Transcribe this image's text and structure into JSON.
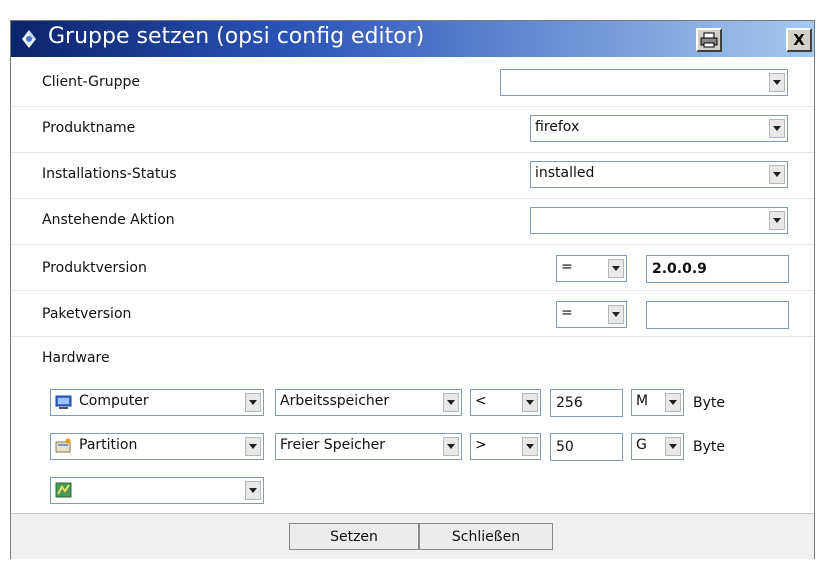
{
  "window": {
    "title": "Gruppe setzen (opsi config editor)",
    "print_icon": "printer-icon",
    "close_label": "X"
  },
  "form": {
    "client_group": {
      "label": "Client-Gruppe",
      "value": ""
    },
    "product_name": {
      "label": "Produktname",
      "value": "firefox"
    },
    "install_status": {
      "label": "Installations-Status",
      "value": "installed"
    },
    "pending_action": {
      "label": "Anstehende Aktion",
      "value": ""
    },
    "product_version": {
      "label": "Produktversion",
      "operator": "=",
      "value": "2.0.0.9"
    },
    "package_version": {
      "label": "Paketversion",
      "operator": "=",
      "value": ""
    }
  },
  "hardware": {
    "label": "Hardware",
    "rows": [
      {
        "device": "Computer",
        "device_icon": "computer-icon",
        "property": "Arbeitsspeicher",
        "operator": "<",
        "value": "256",
        "unit": "M",
        "suffix": "Byte"
      },
      {
        "device": "Partition",
        "device_icon": "partition-icon",
        "property": "Freier Speicher",
        "operator": ">",
        "value": "50",
        "unit": "G",
        "suffix": "Byte"
      }
    ],
    "empty_row": {
      "device": "",
      "device_icon": "network-icon"
    }
  },
  "buttons": {
    "set": "Setzen",
    "close": "Schließen"
  },
  "colors": {
    "title_start": "#0a246a",
    "title_end": "#a6caf0",
    "field_border": "#7f9db9"
  }
}
